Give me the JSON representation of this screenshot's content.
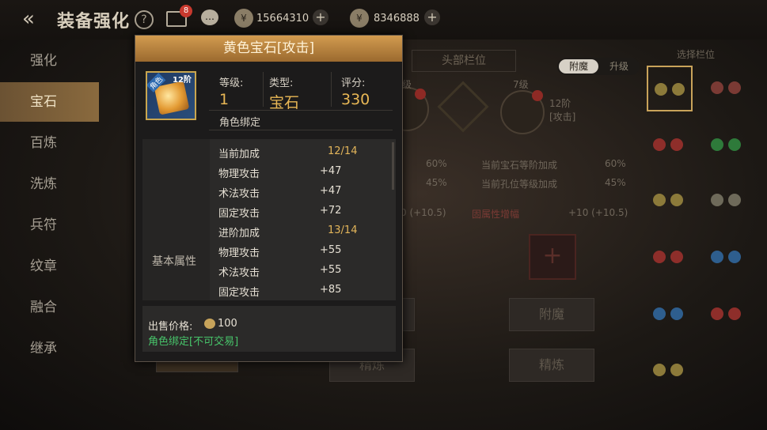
{
  "header": {
    "title": "装备强化",
    "help_icon": "?",
    "mail_badge": "8",
    "currency1": "15664310",
    "currency2": "8346888"
  },
  "sidebar": {
    "items": [
      {
        "label": "强化"
      },
      {
        "label": "宝石"
      },
      {
        "label": "百炼"
      },
      {
        "label": "洗炼"
      },
      {
        "label": "兵符"
      },
      {
        "label": "纹章"
      },
      {
        "label": "融合"
      },
      {
        "label": "继承"
      }
    ],
    "active_index": 1
  },
  "background": {
    "tab_label": "头部栏位",
    "toggle_a": "附魔",
    "toggle_b": "升级",
    "level_left": "级",
    "level_right": "7级",
    "slot_rank": "12阶",
    "slot_type": "[攻击]",
    "pct1": "60%",
    "pct2": "45%",
    "gem_bonus_label": "当前宝石等阶加成",
    "gem_bonus_val": "60%",
    "hole_bonus_label": "当前孔位等级加成",
    "hole_bonus_val": "45%",
    "left_bonus": "0 (+10.5)",
    "attr_label": "固属性增幅",
    "right_bonus": "+10 (+10.5)",
    "btn_enchant": "附魔",
    "btn_refine_1": "精炼",
    "btn_refine_2": "精炼",
    "slot_panel_title": "选择栏位"
  },
  "popup": {
    "title": "黄色宝石[攻击]",
    "icon_rank": "12阶",
    "icon_role": "角色",
    "level_label": "等级:",
    "level_value": "1",
    "type_label": "类型:",
    "type_value": "宝石",
    "score_label": "评分:",
    "score_value": "330",
    "bind_text": "角色绑定",
    "attr_category": "基本属性",
    "attrs": [
      {
        "name": "当前加成",
        "value": "12/14",
        "gold": true
      },
      {
        "name": "物理攻击",
        "value": "+47"
      },
      {
        "name": "术法攻击",
        "value": "+47"
      },
      {
        "name": "固定攻击",
        "value": "+72"
      },
      {
        "name": "进阶加成",
        "value": "13/14",
        "gold": true
      },
      {
        "name": "物理攻击",
        "value": "+55"
      },
      {
        "name": "术法攻击",
        "value": "+55"
      },
      {
        "name": "固定攻击",
        "value": "+85"
      }
    ],
    "price_label": "出售价格:",
    "price_value": "100",
    "trade_text": "角色绑定[不可交易]"
  },
  "colors": {
    "accent_gold": "#e8b755",
    "trade_green": "#47c46a",
    "popup_header": "#c98f45",
    "active_tab": "#8a6a3e"
  }
}
